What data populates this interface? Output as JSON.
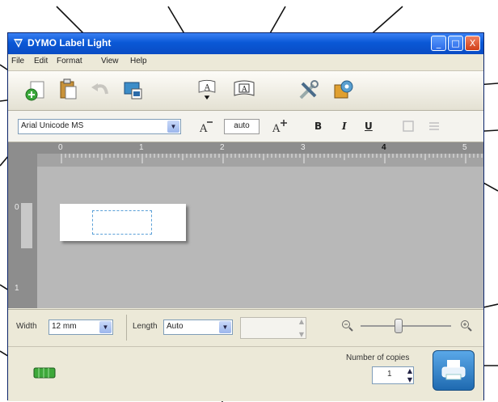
{
  "window": {
    "title": "DYMO Label Light",
    "controls": {
      "minimize": "_",
      "maximize": "□",
      "close": "X"
    }
  },
  "menubar": {
    "items": [
      "File",
      "Edit",
      "Format",
      "View",
      "Help"
    ]
  },
  "toolbar": {
    "icons": [
      "add-icon",
      "paste-icon",
      "undo-icon",
      "insert-image-icon",
      "text-object-icon",
      "text-frame-icon",
      "tools-icon",
      "settings-icon"
    ]
  },
  "format_bar": {
    "font": "Arial Unicode MS",
    "font_size": "auto",
    "bold": "B",
    "italic": "I",
    "underline": "U"
  },
  "ruler": {
    "ticks": [
      "0",
      "1",
      "2",
      "3",
      "4",
      "5"
    ],
    "vertical_ticks": [
      "0",
      "1"
    ]
  },
  "size_bar": {
    "width_label": "Width",
    "width_value": "12 mm",
    "length_label": "Length",
    "length_value": "Auto",
    "zoom_level": 0.42
  },
  "print_panel": {
    "copies_label": "Number of copies",
    "copies_value": "1"
  },
  "colors": {
    "titlebar": "#0a58d6",
    "canvas": "#b8b8b8",
    "ruler": "#8d8d8d",
    "print_button": "#2c7fc2"
  }
}
